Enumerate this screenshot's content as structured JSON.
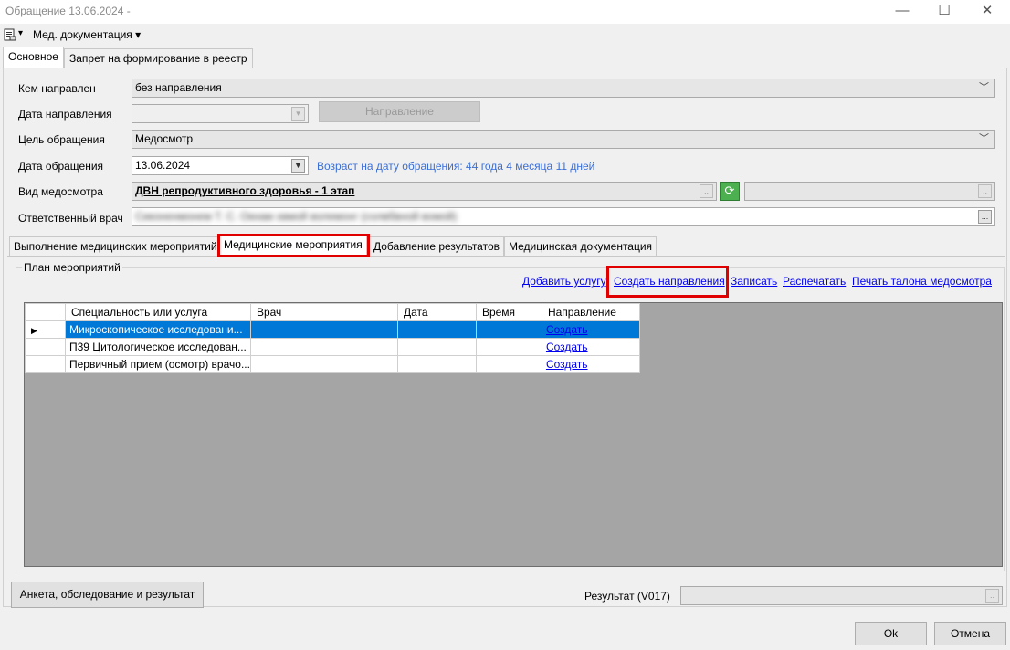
{
  "window": {
    "title": "Обращение 13.06.2024 -",
    "minimize": "—",
    "maximize": "☐",
    "close": "✕"
  },
  "menu": {
    "doc_icon": "document-icon",
    "dropdown_arrow": "▾",
    "med_docs": "Мед. документация ▾"
  },
  "tabs": [
    {
      "label": "Основное"
    },
    {
      "label": "Запрет на формирование в реестр"
    }
  ],
  "form": {
    "referred_by_label": "Кем направлен",
    "referred_by_value": "без направления",
    "referral_date_label": "Дата направления",
    "referral_date_value": "",
    "referral_button": "Направление",
    "purpose_label": "Цель обращения",
    "purpose_value": "Медосмотр",
    "visit_date_label": "Дата обращения",
    "visit_date_value": "13.06.2024",
    "age_text": "Возраст на дату обращения:  44 года 4 месяца 11 дней",
    "exam_type_label": "Вид медосмотра",
    "exam_type_value": "ДВН репродуктивного здоровья - 1 этап",
    "doctor_label": "Ответственный врач",
    "doctor_value": "Сиконенмонем Т. С. Окнам хвмой волемонг (солвбвной вомой)",
    "ellipsis": "..."
  },
  "inner_tabs": [
    {
      "label": "Выполнение медицинских мероприятий"
    },
    {
      "label": "Медицинские мероприятия"
    },
    {
      "label": "Добавление результатов"
    },
    {
      "label": "Медицинская документация"
    }
  ],
  "plan": {
    "group_label": "План мероприятий",
    "links": {
      "add_service": "Добавить услугу",
      "create_referrals": "Создать направления",
      "record": "Записать",
      "print": "Распечатать",
      "print_ticket": "Печать талона медосмотра"
    },
    "columns": [
      "Специальность или услуга",
      "Врач",
      "Дата",
      "Время",
      "Направление"
    ],
    "rows": [
      {
        "service": "Микроскопическое исследовани...",
        "doctor": "",
        "date": "",
        "time": "",
        "referral": "Создать"
      },
      {
        "service": "П39 Цитологическое исследован...",
        "doctor": "",
        "date": "",
        "time": "",
        "referral": "Создать"
      },
      {
        "service": "Первичный прием (осмотр) врачо...",
        "doctor": "",
        "date": "",
        "time": "",
        "referral": "Создать"
      }
    ],
    "row_pointer": "▶"
  },
  "bottom": {
    "survey_button": "Анкета, обследование и результат",
    "result_label": "Результат (V017)",
    "result_value": "",
    "ok_button": "Ok",
    "cancel_button": "Отмена"
  },
  "colors": {
    "selection": "#0078d7",
    "highlight_box": "#e00000",
    "age_text": "#3a6fd8",
    "grid_bg": "#a5a5a5"
  }
}
